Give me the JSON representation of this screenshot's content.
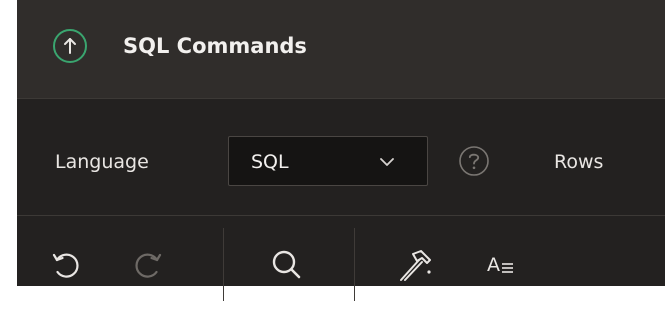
{
  "header": {
    "title": "SQL Commands",
    "accent_color": "#3aa56f",
    "icon": "up-arrow-circle-icon"
  },
  "language_bar": {
    "language_label": "Language",
    "language_select_value": "SQL",
    "help_icon": "help-circle-icon",
    "rows_label": "Rows"
  },
  "toolbar": {
    "undo_icon": "undo-icon",
    "redo_icon": "redo-icon",
    "redo_enabled": false,
    "find_icon": "search-icon",
    "build_icon": "hammer-icon",
    "format_label": "A",
    "format_icon": "format-text-icon"
  },
  "colors": {
    "background": "#232120",
    "header_background": "#302d2b",
    "text": "#e9e6e3",
    "disabled_icon": "#6e6a66"
  }
}
